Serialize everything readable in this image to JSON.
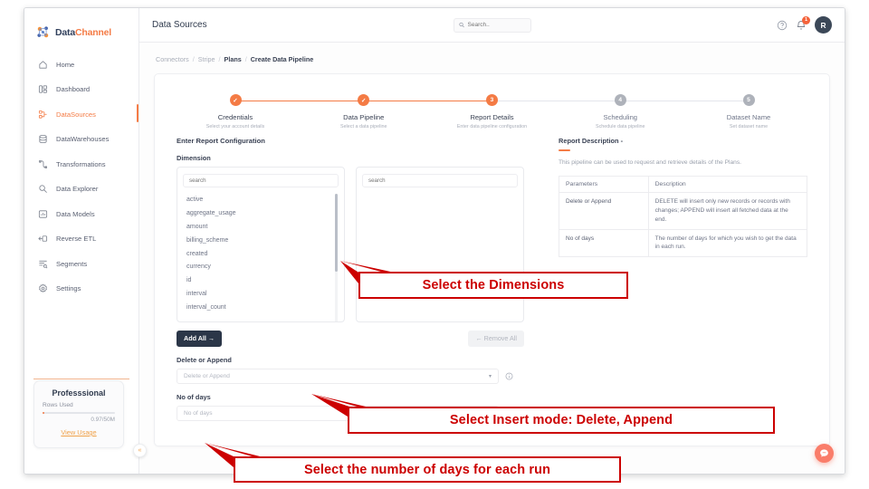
{
  "brand": {
    "part1": "Data",
    "part2": "Channel",
    "logo_icon": "datachannel-logo-icon"
  },
  "sidebar": {
    "items": [
      {
        "label": "Home",
        "icon": "home-icon",
        "active": false
      },
      {
        "label": "Dashboard",
        "icon": "dashboard-icon",
        "active": false
      },
      {
        "label": "DataSources",
        "icon": "datasources-icon",
        "active": true
      },
      {
        "label": "DataWarehouses",
        "icon": "datawarehouses-icon",
        "active": false
      },
      {
        "label": "Transformations",
        "icon": "transformations-icon",
        "active": false
      },
      {
        "label": "Data Explorer",
        "icon": "data-explorer-icon",
        "active": false
      },
      {
        "label": "Data Models",
        "icon": "data-models-icon",
        "active": false
      },
      {
        "label": "Reverse ETL",
        "icon": "reverse-etl-icon",
        "active": false
      },
      {
        "label": "Segments",
        "icon": "segments-icon",
        "active": false
      },
      {
        "label": "Settings",
        "icon": "settings-gear-icon",
        "active": false
      }
    ],
    "plan": {
      "name": "Professsional",
      "rows_used_label": "Rows Used",
      "usage": "0.97/50M",
      "view_usage_label": "View Usage"
    },
    "collapse_glyph": "«"
  },
  "header": {
    "title": "Data Sources",
    "search_placeholder": "Search..",
    "search_value": "",
    "help_icon": "help-circle-icon",
    "notification_icon": "bell-icon",
    "notification_count": "1",
    "avatar_initial": "R"
  },
  "breadcrumb": {
    "items": [
      {
        "label": "Connectors",
        "current": false
      },
      {
        "label": "Stripe",
        "current": false
      },
      {
        "label": "Plans",
        "current": true
      },
      {
        "label": "Create Data Pipeline",
        "current": true
      }
    ],
    "separator": "/"
  },
  "stepper": {
    "steps": [
      {
        "num": "1",
        "name": "Credentials",
        "desc": "Select your account details",
        "state": "done",
        "glyph": "✓"
      },
      {
        "num": "2",
        "name": "Data Pipeline",
        "desc": "Select a data pipeline",
        "state": "done",
        "glyph": "✓"
      },
      {
        "num": "3",
        "name": "Report Details",
        "desc": "Enter data pipeline configuration",
        "state": "current",
        "glyph": "3"
      },
      {
        "num": "4",
        "name": "Scheduling",
        "desc": "Schedule data pipeline",
        "state": "pending",
        "glyph": "4"
      },
      {
        "num": "5",
        "name": "Dataset Name",
        "desc": "Set dataset name",
        "state": "pending",
        "glyph": "5"
      }
    ]
  },
  "form": {
    "section_title": "Enter Report Configuration",
    "dimension_label": "Dimension",
    "available_search_placeholder": "search",
    "selected_search_placeholder": "search",
    "available_options": [
      "active",
      "aggregate_usage",
      "amount",
      "billing_scheme",
      "created",
      "currency",
      "id",
      "interval",
      "interval_count"
    ],
    "selected_options": [],
    "add_all_label": "Add All  →",
    "remove_all_label": "←  Remove All",
    "delete_or_append_label": "Delete or Append",
    "delete_or_append_placeholder": "Delete or Append",
    "delete_or_append_value": "",
    "no_of_days_label": "No of days",
    "no_of_days_placeholder": "No of days",
    "no_of_days_value": "",
    "info_icon": "info-circle-icon",
    "caret_glyph": "▾"
  },
  "report": {
    "title": "Report Description -",
    "description": "This pipeline can be used to request and retrieve details of the Plans.",
    "table": {
      "headers": [
        "Parameters",
        "Description"
      ],
      "rows": [
        {
          "parameter": "Delete or Append",
          "description": "DELETE will insert only new records or records with changes; APPEND will insert all fetched data at the end."
        },
        {
          "parameter": "No of days",
          "description": "The number of days for which you wish to get the data in each run."
        }
      ]
    }
  },
  "chat": {
    "icon": "chat-bubble-icon"
  },
  "annotations": [
    {
      "id": "dimensions",
      "text": "Select the Dimensions"
    },
    {
      "id": "insert-mode",
      "text": "Select Insert mode: Delete, Append"
    },
    {
      "id": "days",
      "text": "Select the number of days for each run"
    }
  ],
  "colors": {
    "accent_orange": "#f47b45",
    "dark_navy": "#2b3648",
    "annotation_red": "#cc0000",
    "avatar_bg": "#3c4858",
    "chat_bg": "#fa7d6a"
  }
}
